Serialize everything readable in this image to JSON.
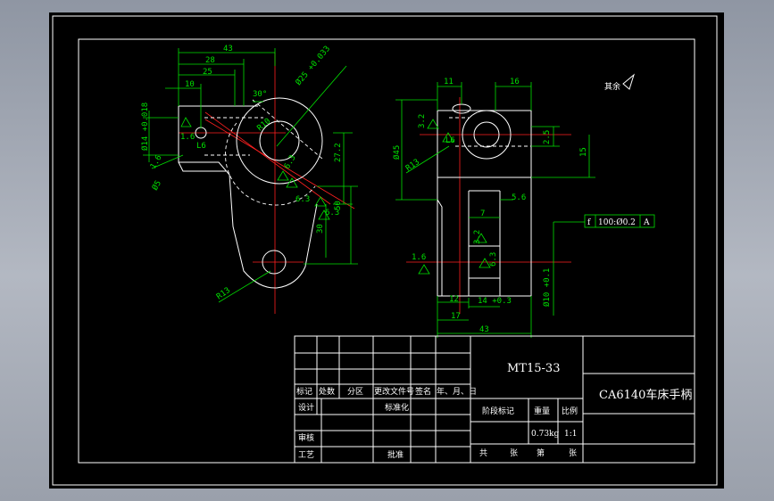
{
  "dims": {
    "left_43": "43",
    "left_28": "28",
    "left_25": "25",
    "left_10": "10",
    "left_30deg": "30°",
    "left_phi25": "Ø25 +0.033",
    "left_phi14": "Ø14 +0.018",
    "left_16a": "1.6",
    "left_16b": "1.6",
    "left_phi5": "Ø5",
    "left_r10": "R10",
    "left_27": "27.2",
    "left_63a": "6.3",
    "left_63b": "6.3",
    "left_50": "50",
    "left_30": "30",
    "left_r13": "R13",
    "right_11": "11",
    "right_16": "16",
    "right_32a": "3.2",
    "right_l6": "L6",
    "right_phi45": "Ø45",
    "right_r13": "R13",
    "right_25": "2.5",
    "right_15": "15",
    "right_56": "5.6",
    "right_7": "7",
    "right_32b": "3.2",
    "right_16c": "1.6",
    "right_63": "6.3",
    "right_12": "12",
    "right_14": "14 +0.3",
    "right_phi10": "Ø10 +0.1",
    "right_17": "17",
    "right_43": "43",
    "left_l6": "L6",
    "roughness_rest": "其余",
    "tol_sym": "f",
    "tol_val": "100:Ø0.2",
    "tol_ref": "A"
  },
  "title_block": {
    "drawing_no": "MT15-33",
    "part_name": "CA6140车床手柄",
    "h_mark": "标记",
    "h_count": "处数",
    "h_zone": "分区",
    "h_docno": "更改文件号",
    "h_sign": "签名",
    "h_date": "年、月、日",
    "design": "设计",
    "standard": "标准化",
    "review": "审核",
    "process": "工艺",
    "approve": "批准",
    "stage_mark": "阶段标记",
    "weight_label": "重量",
    "scale_label": "比例",
    "weight": "0.73kg",
    "scale": "1:1",
    "total": "共",
    "sheets": "张",
    "no": "第",
    "sheet2": "张"
  }
}
